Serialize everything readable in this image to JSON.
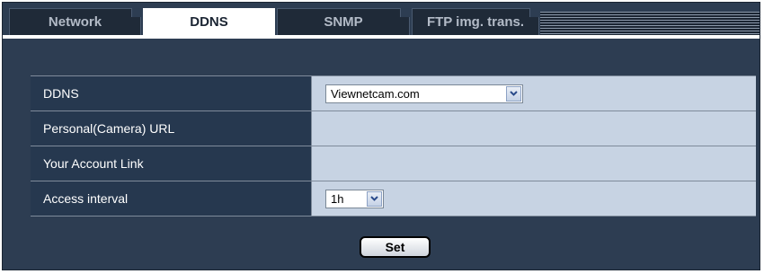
{
  "tabs": [
    {
      "label": "Network",
      "state": "inactive"
    },
    {
      "label": "DDNS",
      "state": "active"
    },
    {
      "label": "SNMP",
      "state": "inactive"
    },
    {
      "label": "FTP img. trans.",
      "state": "inactive"
    }
  ],
  "form": {
    "ddns": {
      "label": "DDNS",
      "value": "Viewnetcam.com"
    },
    "camera_url": {
      "label": "Personal(Camera) URL",
      "value": ""
    },
    "account_link": {
      "label": "Your Account Link",
      "value": ""
    },
    "access_interval": {
      "label": "Access interval",
      "value": "1h"
    }
  },
  "set_button": {
    "label": "Set"
  },
  "icons": {
    "dropdown": "chevron-down-icon"
  },
  "colors": {
    "panel_bg": "#2d3d52",
    "label_cell": "#26384f",
    "value_cell": "#c7d3e3",
    "active_tab": "#ffffff"
  }
}
